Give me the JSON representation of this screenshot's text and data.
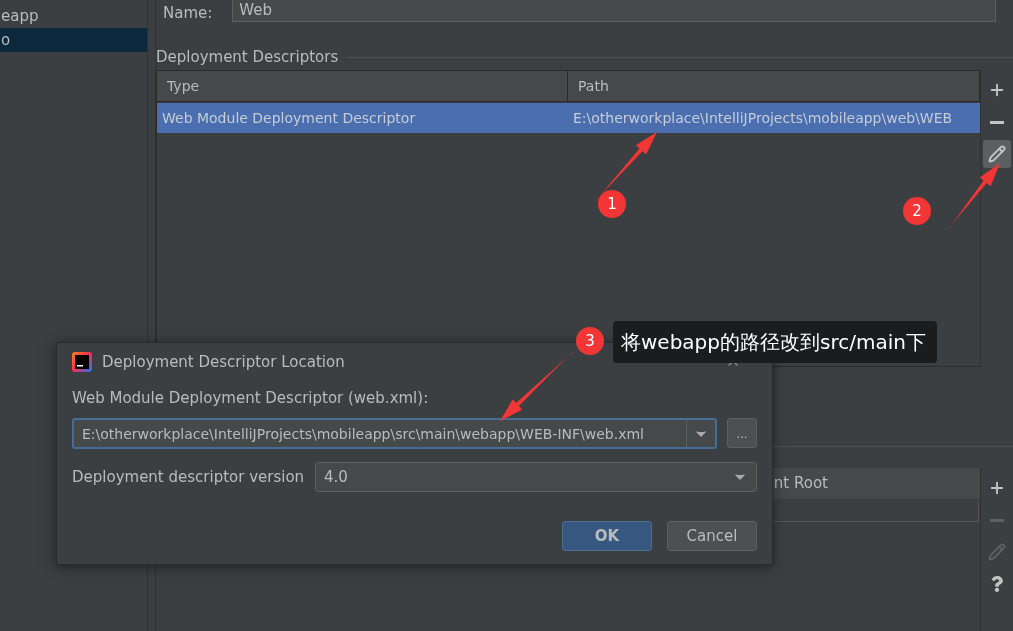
{
  "sidebar": {
    "items": [
      {
        "label": "eapp",
        "selected": false
      },
      {
        "label": "o",
        "selected": true
      }
    ]
  },
  "name_field": {
    "label": "Name:",
    "value": "Web"
  },
  "deployment_descriptors": {
    "title": "Deployment Descriptors",
    "columns": [
      "Type",
      "Path"
    ],
    "rows": [
      {
        "cells": [
          "Web Module Deployment Descriptor",
          "E:\\otherworkplace\\IntelliJProjects\\mobileapp\\web\\WEB"
        ],
        "selected": true
      }
    ],
    "toolbar": [
      {
        "kind": "add",
        "disabled": false,
        "hovered": false
      },
      {
        "kind": "remove",
        "disabled": false,
        "hovered": false
      },
      {
        "kind": "edit",
        "disabled": false,
        "hovered": true
      }
    ]
  },
  "resource_table": {
    "columns": [
      "nt Root"
    ],
    "toolbar": [
      {
        "kind": "add",
        "disabled": false,
        "hovered": false
      },
      {
        "kind": "remove",
        "disabled": true,
        "hovered": false
      },
      {
        "kind": "edit",
        "disabled": true,
        "hovered": false
      },
      {
        "kind": "help",
        "disabled": false,
        "hovered": false
      }
    ]
  },
  "dialog": {
    "title": "Deployment Descriptor Location",
    "descriptor_label": "Web Module Deployment Descriptor (web.xml):",
    "descriptor_path": "E:\\otherworkplace\\IntelliJProjects\\mobileapp\\src\\main\\webapp\\WEB-INF\\web.xml",
    "browse_button": "...",
    "version_label": "Deployment descriptor version",
    "version_value": "4.0",
    "buttons": [
      {
        "label": "OK",
        "kind": "primary"
      },
      {
        "label": "Cancel",
        "kind": "secondary"
      }
    ]
  },
  "annotations": {
    "markers": [
      "1",
      "2",
      "3"
    ],
    "callout": "将webapp的路径改到src/main下"
  }
}
